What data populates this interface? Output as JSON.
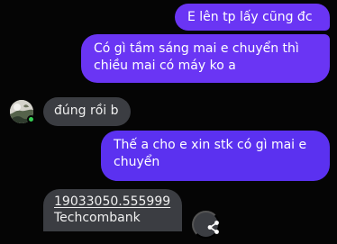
{
  "messages": [
    {
      "side": "sent",
      "text": "E lên tp lấy cũng đc"
    },
    {
      "side": "sent",
      "line1": "Có gì tầm sáng mai e chuyển thì",
      "line2": "chiều mai có máy ko a"
    },
    {
      "side": "received",
      "text": "đúng rồi b"
    },
    {
      "side": "sent",
      "line1": "Thế a cho e xin stk có gì mai e",
      "line2": "chuyển"
    },
    {
      "side": "received",
      "account_number": "19033050.555999",
      "bank": "Techcombank"
    }
  ],
  "icons": {
    "avatar": "contact-avatar",
    "online": "online-status-dot",
    "share": "share-icon"
  },
  "colors": {
    "background": "#050505",
    "sent_bubble": "#6a35f4",
    "received_bubble": "#3b3d42",
    "online_status": "#36d055"
  }
}
